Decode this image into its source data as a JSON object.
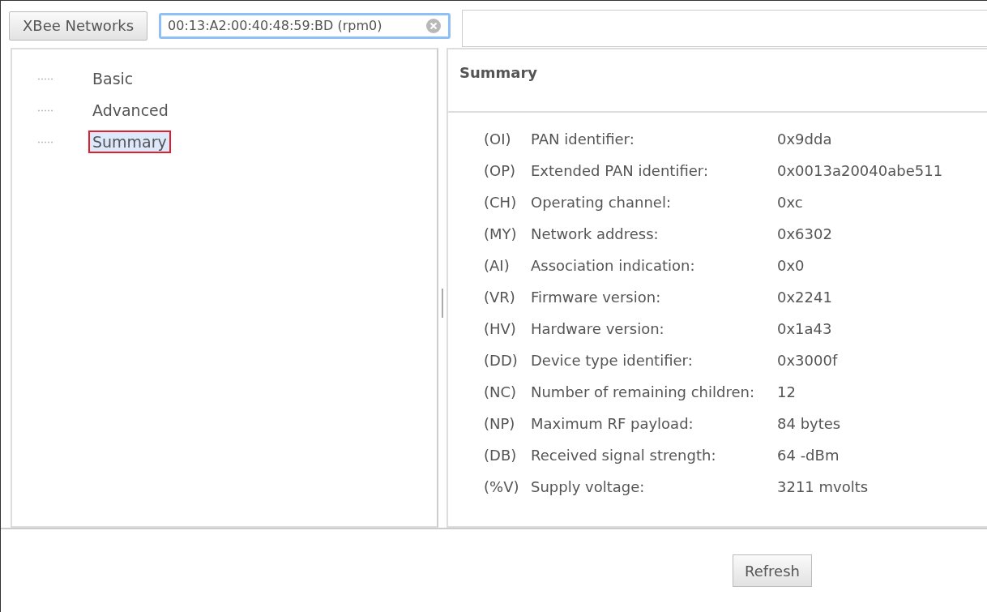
{
  "tabs": [
    {
      "label": "XBee Networks",
      "kind": "button",
      "selected": false
    },
    {
      "label": "00:13:A2:00:40:48:59:BD (rpm0)",
      "kind": "field",
      "selected": true
    }
  ],
  "tree": {
    "items": [
      {
        "label": "Basic",
        "selected": false
      },
      {
        "label": "Advanced",
        "selected": false
      },
      {
        "label": "Summary",
        "selected": true
      }
    ]
  },
  "summary": {
    "title": "Summary",
    "rows": [
      {
        "code": "(OI)",
        "label": "PAN identifier:",
        "value": "0x9dda"
      },
      {
        "code": "(OP)",
        "label": "Extended PAN identifier:",
        "value": "0x0013a20040abe511"
      },
      {
        "code": "(CH)",
        "label": "Operating channel:",
        "value": "0xc"
      },
      {
        "code": "(MY)",
        "label": "Network address:",
        "value": "0x6302"
      },
      {
        "code": "(AI)",
        "label": "Association indication:",
        "value": "0x0"
      },
      {
        "code": "(VR)",
        "label": "Firmware version:",
        "value": "0x2241"
      },
      {
        "code": "(HV)",
        "label": "Hardware version:",
        "value": "0x1a43"
      },
      {
        "code": "(DD)",
        "label": "Device type identifier:",
        "value": "0x3000f"
      },
      {
        "code": "(NC)",
        "label": "Number of remaining children:",
        "value": "12"
      },
      {
        "code": "(NP)",
        "label": "Maximum RF payload:",
        "value": "84 bytes"
      },
      {
        "code": "(DB)",
        "label": "Received signal strength:",
        "value": "64 -dBm"
      },
      {
        "code": "(%V)",
        "label": "Supply voltage:",
        "value": "3211 mvolts"
      }
    ]
  },
  "refresh_button": "Refresh"
}
